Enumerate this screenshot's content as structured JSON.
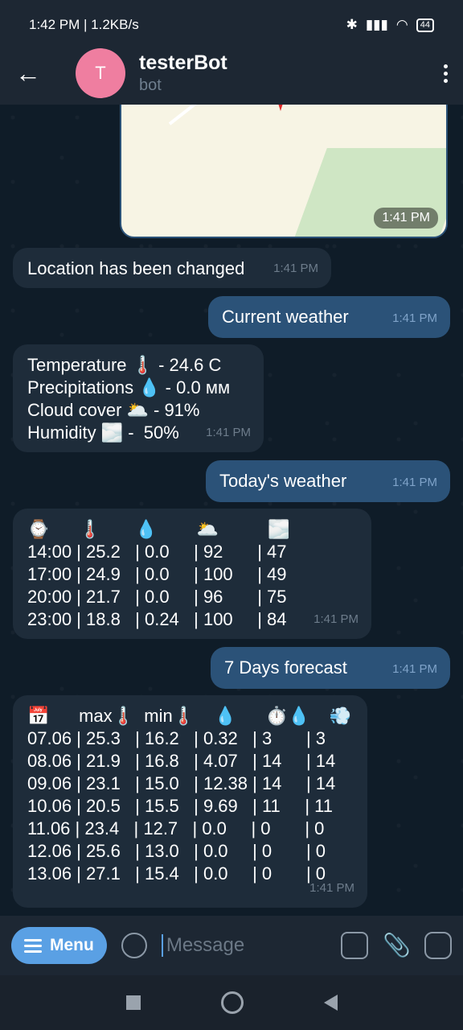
{
  "status_bar": {
    "time_speed": "1:42 PM | 1.2KB/s",
    "battery": "44"
  },
  "header": {
    "back_icon": "arrow-left-icon",
    "avatar_letter": "T",
    "avatar_color": "#ef7ea0",
    "title": "testerBot",
    "subtitle": "bot"
  },
  "messages": {
    "map_time": "1:41 PM",
    "m1": {
      "text": "Location has been changed",
      "time": "1:41 PM"
    },
    "m2": {
      "text": "Current weather",
      "time": "1:41 PM"
    },
    "m3": {
      "lines": [
        "Temperature 🌡️ - 24.6 C",
        "Precipitations 💧 - 0.0 мм",
        "Cloud cover 🌥️ - 91%",
        "Humidity 🌫️ -  50%"
      ],
      "time": "1:41 PM"
    },
    "m4": {
      "text": "Today's weather",
      "time": "1:41 PM"
    },
    "m5": {
      "header": "⌚      🌡️       💧        🌥️          🌫️",
      "rows": [
        "14:00 | 25.2   | 0.0     | 92       | 47",
        "17:00 | 24.9   | 0.0     | 100     | 49",
        "20:00 | 21.7   | 0.0     | 96       | 75",
        "23:00 | 18.8   | 0.24   | 100     | 84"
      ],
      "time": "1:41 PM"
    },
    "m6": {
      "text": "7 Days forecast",
      "time": "1:41 PM"
    },
    "m7": {
      "header": "📅      max🌡️  min🌡️    💧      ⏱️💧    💨",
      "rows": [
        "07.06 | 25.3   | 16.2   | 0.32   | 3       | 3",
        "08.06 | 21.9   | 16.8   | 4.07   | 14     | 14",
        "09.06 | 23.1   | 15.0   | 12.38 | 14     | 14",
        "10.06 | 20.5   | 15.5   | 9.69   | 11     | 11",
        "11.06 | 23.4   | 12.7   | 0.0     | 0       | 0",
        "12.06 | 25.6   | 13.0   | 0.0     | 0       | 0",
        "13.06 | 27.1   | 15.4   | 0.0     | 0       | 0"
      ],
      "time": "1:41 PM"
    }
  },
  "input": {
    "menu_label": "Menu",
    "placeholder": "Message"
  }
}
